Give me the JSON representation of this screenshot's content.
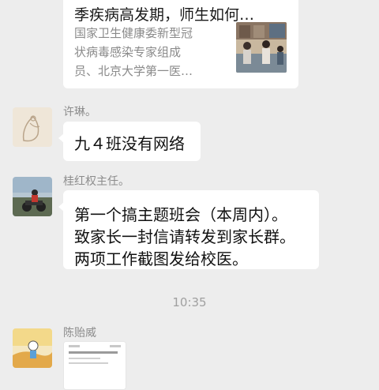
{
  "article": {
    "title": "季疾病高发期，师生如何…",
    "desc_lines": [
      "国家卫生健康委新型冠",
      "状病毒感染专家组成",
      "员、北京大学第一医…"
    ]
  },
  "messages": [
    {
      "sender": "许琳。",
      "lines": [
        "九４班没有网络"
      ]
    },
    {
      "sender": "桂红权主任。",
      "lines": [
        "第一个搞主题班会（本周内）。",
        "致家长一封信请转发到家长群。",
        "两项工作截图发给校医。"
      ]
    },
    {
      "sender": "陈贻威"
    }
  ],
  "timestamp": "10:35",
  "colors": {
    "background": "#ededed",
    "bubble": "#ffffff",
    "meta_text": "#8c8c8c"
  }
}
